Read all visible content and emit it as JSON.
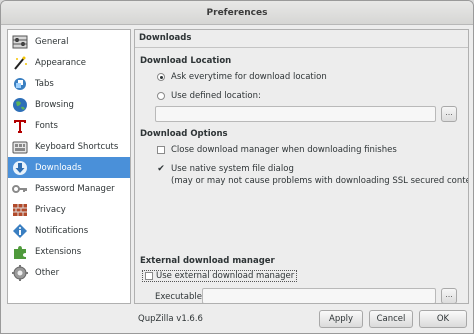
{
  "window": {
    "title": "Preferences"
  },
  "sidebar": {
    "items": [
      {
        "label": "General",
        "icon": "general-icon",
        "selected": false
      },
      {
        "label": "Appearance",
        "icon": "appearance-icon",
        "selected": false
      },
      {
        "label": "Tabs",
        "icon": "tabs-icon",
        "selected": false
      },
      {
        "label": "Browsing",
        "icon": "browsing-icon",
        "selected": false
      },
      {
        "label": "Fonts",
        "icon": "fonts-icon",
        "selected": false
      },
      {
        "label": "Keyboard Shortcuts",
        "icon": "keyboard-icon",
        "selected": false
      },
      {
        "label": "Downloads",
        "icon": "downloads-icon",
        "selected": true
      },
      {
        "label": "Password Manager",
        "icon": "key-icon",
        "selected": false
      },
      {
        "label": "Privacy",
        "icon": "brick-wall-icon",
        "selected": false
      },
      {
        "label": "Notifications",
        "icon": "info-icon",
        "selected": false
      },
      {
        "label": "Extensions",
        "icon": "puzzle-icon",
        "selected": false
      },
      {
        "label": "Other",
        "icon": "gear-icon",
        "selected": false
      }
    ]
  },
  "content": {
    "page_title": "Downloads",
    "download_location": {
      "heading": "Download Location",
      "ask_label": "Ask everytime for download location",
      "ask_selected": true,
      "defined_label": "Use defined location:",
      "defined_selected": false,
      "path_value": "",
      "browse_label": "..."
    },
    "download_options": {
      "heading": "Download Options",
      "close_manager_label": "Close download manager when downloading finishes",
      "close_manager_checked": false,
      "native_dialog_label": "Use native system file dialog",
      "native_dialog_note": "(may or may not cause problems with downloading SSL secured content)",
      "native_dialog_checked": true
    },
    "external_manager": {
      "heading": "External download manager",
      "use_external_label": "Use external download manager",
      "use_external_checked": false,
      "executable_label": "Executable:",
      "executable_value": "",
      "browse_label": "..."
    }
  },
  "footer": {
    "version": "QupZilla v1.6.6",
    "apply_label": "Apply",
    "cancel_label": "Cancel",
    "ok_label": "OK"
  },
  "colors": {
    "selection": "#4a90d9",
    "window_bg": "#ededed"
  }
}
